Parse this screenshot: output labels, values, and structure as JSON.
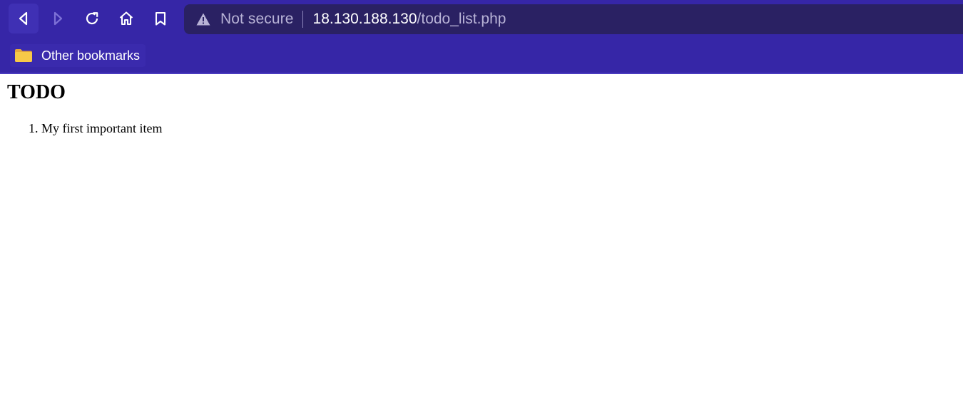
{
  "browser": {
    "security_text": "Not secure",
    "url_host": "18.130.188.130",
    "url_path": "/todo_list.php",
    "bookmarks": [
      {
        "label": "Other bookmarks",
        "icon": "folder-icon"
      }
    ],
    "colors": {
      "chrome": "#3626a7",
      "omnibox": "#2a2163",
      "folder": "#f7c948"
    }
  },
  "page": {
    "heading": "TODO",
    "items": [
      {
        "text": "My first important item"
      }
    ]
  }
}
